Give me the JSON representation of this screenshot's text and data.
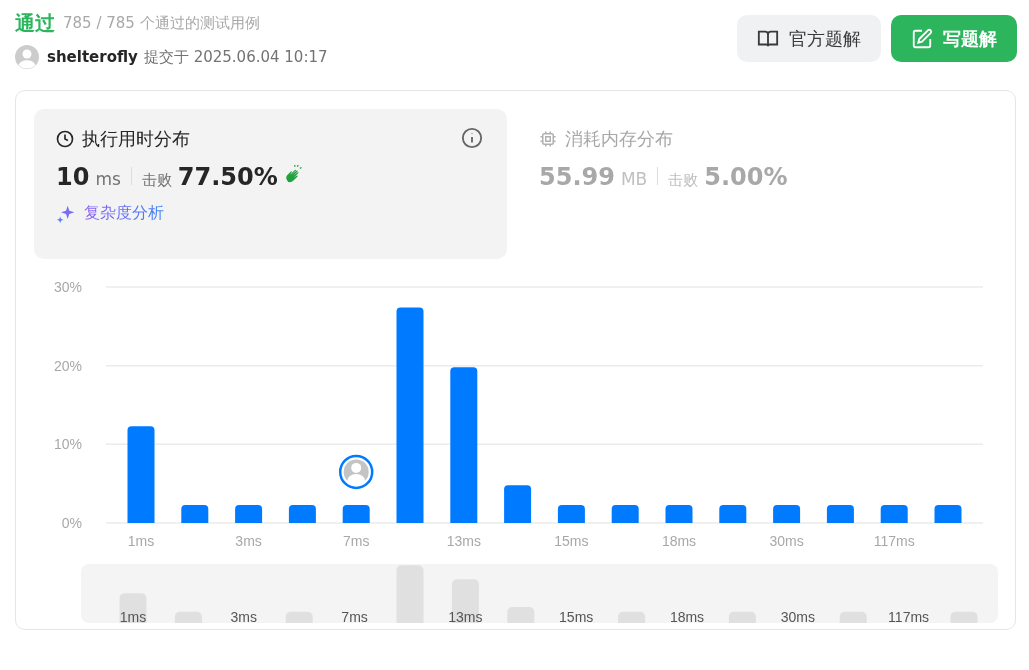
{
  "header": {
    "status": "通过",
    "count": "785 / 785 个通过的测试用例",
    "user": "shelterofly",
    "submitted": "提交于 2025.06.04 10:17"
  },
  "actions": [
    {
      "kind": "book",
      "label": "官方题解"
    },
    {
      "kind": "edit",
      "label": "写题解"
    }
  ],
  "panels": [
    {
      "kind": "time",
      "title": "执行用时分布",
      "selected": true,
      "value": "10",
      "unit": "ms",
      "beat_label": "击败",
      "beat": "77.50%",
      "link": "复杂度分析"
    },
    {
      "kind": "memory",
      "title": "消耗内存分布",
      "selected": false,
      "value": "55.99",
      "unit": "MB",
      "beat_label": "击败",
      "beat": "5.00%"
    }
  ],
  "chart_data": {
    "type": "bar",
    "categories": [
      "1ms",
      null,
      "3ms",
      null,
      "7ms",
      null,
      "13ms",
      null,
      "15ms",
      null,
      "18ms",
      null,
      "30ms",
      null,
      "117ms",
      null
    ],
    "series": [
      {
        "color": "#007aff",
        "values": [
          12.3,
          2.3,
          2.3,
          2.3,
          2.3,
          27.4,
          19.8,
          4.8,
          2.3,
          2.3,
          2.3,
          2.3,
          2.3,
          2.3,
          2.3,
          2.3
        ]
      }
    ],
    "ylim": [
      0,
      30
    ],
    "yticks": [
      {
        "value": 0,
        "label": "0%"
      },
      {
        "value": 10,
        "label": "10%"
      },
      {
        "value": 20,
        "label": "20%"
      },
      {
        "value": 30,
        "label": "30%"
      }
    ],
    "annotations": [
      {
        "x": "7ms"
      }
    ]
  },
  "overview": {
    "labels": [
      "1ms",
      "3ms",
      "7ms",
      "13ms",
      "15ms",
      "18ms",
      "30ms",
      "117ms"
    ]
  }
}
